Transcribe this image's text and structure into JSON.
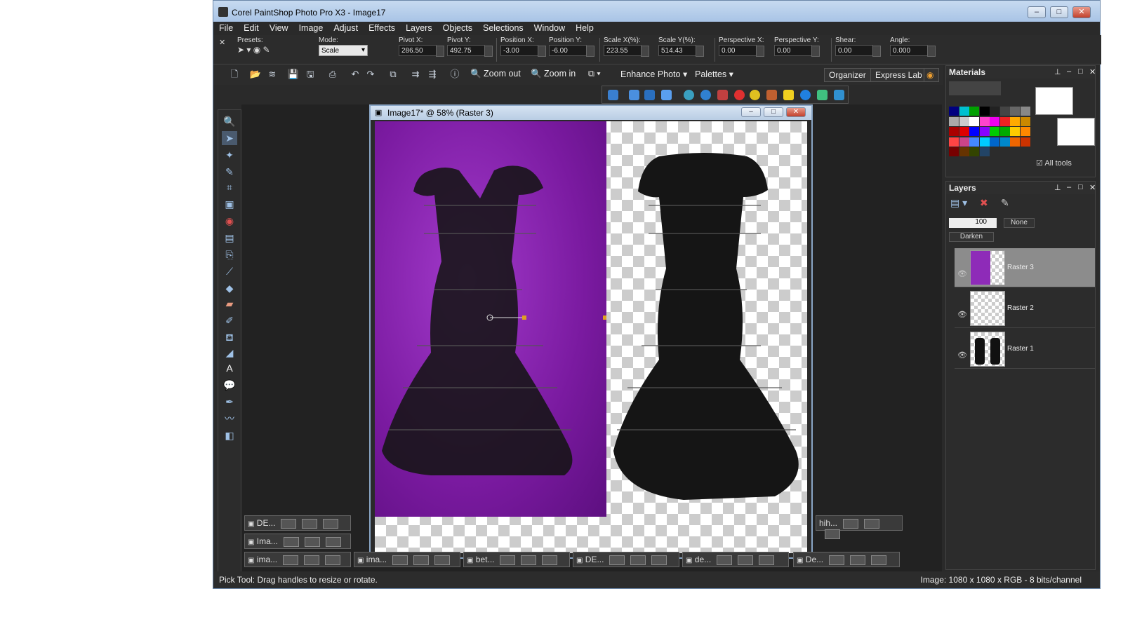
{
  "window": {
    "title": "Corel PaintShop Photo Pro X3 - Image17",
    "min": "–",
    "max": "□",
    "close": "✕"
  },
  "menu": [
    "File",
    "Edit",
    "View",
    "Image",
    "Adjust",
    "Effects",
    "Layers",
    "Objects",
    "Selections",
    "Window",
    "Help"
  ],
  "toolopts": {
    "presets_label": "Presets:",
    "mode_label": "Mode:",
    "mode_value": "Scale",
    "pivot_x_label": "Pivot X:",
    "pivot_x": "286.50",
    "pivot_y_label": "Pivot Y:",
    "pivot_y": "492.75",
    "pos_x_label": "Position X:",
    "pos_x": "-3.00",
    "pos_y_label": "Position Y:",
    "pos_y": "-6.00",
    "scale_x_label": "Scale X(%):",
    "scale_x": "223.55",
    "scale_y_label": "Scale Y(%):",
    "scale_y": "514.43",
    "persp_x_label": "Perspective X:",
    "persp_x": "0.00",
    "persp_y_label": "Perspective Y:",
    "persp_y": "0.00",
    "shear_label": "Shear:",
    "shear": "0.00",
    "angle_label": "Angle:",
    "angle": "0.000"
  },
  "stdbar": {
    "zoom_out": "Zoom out",
    "zoom_in": "Zoom in",
    "enhance": "Enhance Photo",
    "palettes": "Palettes",
    "organizer": "Organizer",
    "express_lab": "Express Lab"
  },
  "document": {
    "title": "Image17* @  58% (Raster 3)"
  },
  "taskbar": [
    "DE...",
    "Ima...",
    "ima...",
    "ima...",
    "bet...",
    "DE...",
    "de...",
    "De...",
    "hih..."
  ],
  "status": {
    "left": "Pick Tool: Drag handles to resize or rotate.",
    "right": "Image:  1080 x 1080 x RGB - 8 bits/channel"
  },
  "materials": {
    "title": "Materials",
    "all_tools": "All tools"
  },
  "layers": {
    "title": "Layers",
    "opacity": "100",
    "blend": "Darken",
    "mask": "None",
    "items": [
      "Raster 3",
      "Raster 2",
      "Raster 1"
    ]
  },
  "colors": {
    "accent": "#a9c4e6",
    "purple": "#8e2bb8"
  }
}
